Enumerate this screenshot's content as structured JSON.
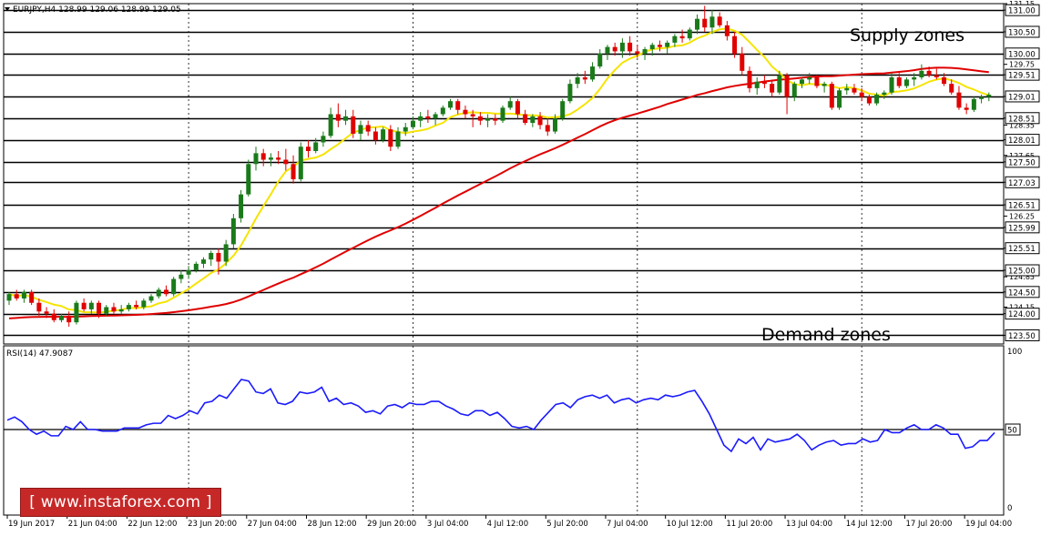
{
  "header": {
    "symbol_label": "EURJPY,H4 128.99 129.06 128.99 129.05",
    "rsi_label": "RSI(14) 47.9087"
  },
  "annotations": {
    "supply": "Supply zones",
    "demand": "Demand zones"
  },
  "watermark": "[ www.instaforex.com ]",
  "colors": {
    "background": "#ffffff",
    "bull_candle": "#1a7a1a",
    "bear_candle": "#e00000",
    "ma_fast": "#f5e400",
    "ma_slow": "#e00000",
    "rsi_line": "#1a1aff",
    "level_line": "#000000",
    "grid": "#000000",
    "watermark_bg": "#c62828"
  },
  "chart_data": [
    {
      "type": "candlestick",
      "title": "EURJPY,H4 128.99 129.06 128.99 129.05",
      "ylim": [
        123.3,
        131.15
      ],
      "y_ticks": [
        "131.15",
        "131.00",
        "130.50",
        "129.75",
        "129.51",
        "129.01",
        "128.51",
        "128.35",
        "128.01",
        "127.65",
        "127.50",
        "127.03",
        "126.51",
        "126.25",
        "125.99",
        "125.51",
        "125.00",
        "124.85",
        "124.50",
        "124.15",
        "124.00",
        "123.50"
      ],
      "horizontal_levels": [
        131.0,
        130.5,
        130.0,
        129.51,
        129.01,
        128.51,
        128.01,
        127.5,
        127.03,
        126.51,
        125.99,
        125.51,
        125.0,
        124.5,
        124.0,
        123.5
      ],
      "level_labels": [
        "131.00",
        "130.50",
        "130.00",
        "129.51",
        "129.01",
        "128.51",
        "128.01",
        "127.50",
        "127.03",
        "126.51",
        "125.99",
        "125.51",
        "125.00",
        "124.50",
        "124.00",
        "123.50"
      ],
      "x_tick_labels": [
        "19 Jun 2017",
        "21 Jun 04:00",
        "22 Jun 12:00",
        "23 Jun 20:00",
        "27 Jun 04:00",
        "28 Jun 12:00",
        "29 Jun 20:00",
        "3 Jul 04:00",
        "4 Jul 12:00",
        "5 Jul 20:00",
        "7 Jul 04:00",
        "10 Jul 12:00",
        "11 Jul 20:00",
        "13 Jul 04:00",
        "14 Jul 12:00",
        "17 Jul 20:00",
        "19 Jul 04:00"
      ],
      "x_tick_candle_index": [
        0,
        8,
        16,
        24,
        32,
        40,
        48,
        56,
        64,
        72,
        80,
        88,
        96,
        104,
        112,
        120,
        128
      ],
      "vertical_grid_candle_index": [
        24,
        54,
        84,
        114
      ],
      "ohlc": [
        [
          124.3,
          124.5,
          124.2,
          124.45
        ],
        [
          124.45,
          124.55,
          124.3,
          124.35
        ],
        [
          124.35,
          124.55,
          124.25,
          124.5
        ],
        [
          124.5,
          124.55,
          124.2,
          124.25
        ],
        [
          124.25,
          124.35,
          123.95,
          124.05
        ],
        [
          124.05,
          124.15,
          123.9,
          124.0
        ],
        [
          124.0,
          124.1,
          123.8,
          123.85
        ],
        [
          123.85,
          124.0,
          123.8,
          123.95
        ],
        [
          123.95,
          124.05,
          123.7,
          123.8
        ],
        [
          123.8,
          124.3,
          123.75,
          124.25
        ],
        [
          124.25,
          124.35,
          124.05,
          124.1
        ],
        [
          124.1,
          124.3,
          124.0,
          124.25
        ],
        [
          124.25,
          124.3,
          123.9,
          124.0
        ],
        [
          124.0,
          124.2,
          123.95,
          124.15
        ],
        [
          124.15,
          124.25,
          124.0,
          124.05
        ],
        [
          124.05,
          124.2,
          124.0,
          124.1
        ],
        [
          124.1,
          124.25,
          124.05,
          124.2
        ],
        [
          124.2,
          124.3,
          124.1,
          124.15
        ],
        [
          124.15,
          124.35,
          124.1,
          124.3
        ],
        [
          124.3,
          124.45,
          124.25,
          124.4
        ],
        [
          124.4,
          124.6,
          124.35,
          124.55
        ],
        [
          124.55,
          124.65,
          124.4,
          124.45
        ],
        [
          124.45,
          124.85,
          124.4,
          124.8
        ],
        [
          124.8,
          125.0,
          124.7,
          124.9
        ],
        [
          124.9,
          125.1,
          124.8,
          125.0
        ],
        [
          125.0,
          125.2,
          124.95,
          125.15
        ],
        [
          125.15,
          125.3,
          125.05,
          125.25
        ],
        [
          125.25,
          125.45,
          125.1,
          125.4
        ],
        [
          125.4,
          125.5,
          124.9,
          125.2
        ],
        [
          125.2,
          125.7,
          125.1,
          125.6
        ],
        [
          125.6,
          126.3,
          125.5,
          126.2
        ],
        [
          126.2,
          126.85,
          126.1,
          126.75
        ],
        [
          126.75,
          127.55,
          126.7,
          127.45
        ],
        [
          127.45,
          127.85,
          127.3,
          127.7
        ],
        [
          127.7,
          127.8,
          127.4,
          127.55
        ],
        [
          127.55,
          127.7,
          127.4,
          127.6
        ],
        [
          127.6,
          127.75,
          127.45,
          127.55
        ],
        [
          127.55,
          127.8,
          127.3,
          127.45
        ],
        [
          127.45,
          127.65,
          127.0,
          127.1
        ],
        [
          127.1,
          127.95,
          127.05,
          127.85
        ],
        [
          127.85,
          128.0,
          127.6,
          127.75
        ],
        [
          127.75,
          128.05,
          127.7,
          127.95
        ],
        [
          127.95,
          128.2,
          127.85,
          128.1
        ],
        [
          128.1,
          128.75,
          128.05,
          128.6
        ],
        [
          128.6,
          128.85,
          128.3,
          128.45
        ],
        [
          128.45,
          128.7,
          128.35,
          128.55
        ],
        [
          128.55,
          128.7,
          128.05,
          128.15
        ],
        [
          128.15,
          128.45,
          128.0,
          128.35
        ],
        [
          128.35,
          128.45,
          128.1,
          128.2
        ],
        [
          128.2,
          128.3,
          127.9,
          128.0
        ],
        [
          128.0,
          128.3,
          127.95,
          128.25
        ],
        [
          128.25,
          128.35,
          127.75,
          127.85
        ],
        [
          127.85,
          128.3,
          127.8,
          128.2
        ],
        [
          128.2,
          128.4,
          128.1,
          128.3
        ],
        [
          128.3,
          128.55,
          128.25,
          128.45
        ],
        [
          128.45,
          128.65,
          128.3,
          128.55
        ],
        [
          128.55,
          128.7,
          128.4,
          128.5
        ],
        [
          128.5,
          128.65,
          128.35,
          128.6
        ],
        [
          128.6,
          128.8,
          128.55,
          128.75
        ],
        [
          128.75,
          128.95,
          128.7,
          128.9
        ],
        [
          128.9,
          128.95,
          128.6,
          128.7
        ],
        [
          128.7,
          128.8,
          128.5,
          128.6
        ],
        [
          128.6,
          128.7,
          128.3,
          128.55
        ],
        [
          128.55,
          128.65,
          128.35,
          128.45
        ],
        [
          128.45,
          128.6,
          128.3,
          128.5
        ],
        [
          128.5,
          128.6,
          128.35,
          128.45
        ],
        [
          128.45,
          128.8,
          128.4,
          128.75
        ],
        [
          128.75,
          129.0,
          128.7,
          128.9
        ],
        [
          128.9,
          128.95,
          128.5,
          128.6
        ],
        [
          128.6,
          128.7,
          128.35,
          128.4
        ],
        [
          128.4,
          128.6,
          128.3,
          128.55
        ],
        [
          128.55,
          128.65,
          128.25,
          128.35
        ],
        [
          128.35,
          128.5,
          128.1,
          128.2
        ],
        [
          128.2,
          128.6,
          128.15,
          128.5
        ],
        [
          128.5,
          128.95,
          128.45,
          128.9
        ],
        [
          128.9,
          129.4,
          128.85,
          129.3
        ],
        [
          129.3,
          129.55,
          129.2,
          129.45
        ],
        [
          129.45,
          129.6,
          129.3,
          129.4
        ],
        [
          129.4,
          129.8,
          129.35,
          129.7
        ],
        [
          129.7,
          130.1,
          129.65,
          130.0
        ],
        [
          130.0,
          130.2,
          129.85,
          130.15
        ],
        [
          130.15,
          130.25,
          129.95,
          130.05
        ],
        [
          130.05,
          130.35,
          129.9,
          130.25
        ],
        [
          130.25,
          130.4,
          129.95,
          130.05
        ],
        [
          130.05,
          130.2,
          129.9,
          130.0
        ],
        [
          130.0,
          130.15,
          129.85,
          130.1
        ],
        [
          130.1,
          130.25,
          129.95,
          130.2
        ],
        [
          130.2,
          130.3,
          130.05,
          130.15
        ],
        [
          130.15,
          130.3,
          130.0,
          130.25
        ],
        [
          130.25,
          130.45,
          130.15,
          130.4
        ],
        [
          130.4,
          130.55,
          130.25,
          130.35
        ],
        [
          130.35,
          130.6,
          130.3,
          130.55
        ],
        [
          130.55,
          130.9,
          130.45,
          130.8
        ],
        [
          130.8,
          131.1,
          130.5,
          130.6
        ],
        [
          130.6,
          131.0,
          130.45,
          130.85
        ],
        [
          130.85,
          130.95,
          130.6,
          130.65
        ],
        [
          130.65,
          130.75,
          130.3,
          130.4
        ],
        [
          130.4,
          130.5,
          129.9,
          130.0
        ],
        [
          130.0,
          130.15,
          129.5,
          129.6
        ],
        [
          129.6,
          129.7,
          129.1,
          129.2
        ],
        [
          129.2,
          129.45,
          129.05,
          129.35
        ],
        [
          129.35,
          129.5,
          129.2,
          129.3
        ],
        [
          129.3,
          129.4,
          129.0,
          129.1
        ],
        [
          129.1,
          129.6,
          129.05,
          129.5
        ],
        [
          129.5,
          129.55,
          128.6,
          129.0
        ],
        [
          129.0,
          129.35,
          128.9,
          129.3
        ],
        [
          129.3,
          129.45,
          129.2,
          129.4
        ],
        [
          129.4,
          129.55,
          129.3,
          129.45
        ],
        [
          129.45,
          129.5,
          129.2,
          129.25
        ],
        [
          129.25,
          129.35,
          129.1,
          129.3
        ],
        [
          129.3,
          129.35,
          128.7,
          128.75
        ],
        [
          128.75,
          129.2,
          128.7,
          129.15
        ],
        [
          129.15,
          129.3,
          129.05,
          129.2
        ],
        [
          129.2,
          129.3,
          129.05,
          129.1
        ],
        [
          129.1,
          129.2,
          128.9,
          129.0
        ],
        [
          129.0,
          129.05,
          128.8,
          128.85
        ],
        [
          128.85,
          129.1,
          128.8,
          129.05
        ],
        [
          129.05,
          129.15,
          128.95,
          129.1
        ],
        [
          129.1,
          129.55,
          129.05,
          129.45
        ],
        [
          129.45,
          129.55,
          129.2,
          129.25
        ],
        [
          129.25,
          129.45,
          129.2,
          129.4
        ],
        [
          129.4,
          129.55,
          129.25,
          129.45
        ],
        [
          129.45,
          129.75,
          129.4,
          129.6
        ],
        [
          129.6,
          129.7,
          129.45,
          129.5
        ],
        [
          129.5,
          129.65,
          129.4,
          129.45
        ],
        [
          129.45,
          129.55,
          129.25,
          129.3
        ],
        [
          129.3,
          129.4,
          129.05,
          129.1
        ],
        [
          129.1,
          129.25,
          128.7,
          128.75
        ],
        [
          128.75,
          128.85,
          128.6,
          128.7
        ],
        [
          128.7,
          129.0,
          128.65,
          128.95
        ],
        [
          128.95,
          129.05,
          128.85,
          129.0
        ],
        [
          129.0,
          129.1,
          128.9,
          129.05
        ]
      ],
      "moving_averages": [
        {
          "name": "fast",
          "color": "#f5e400",
          "period": 8
        },
        {
          "name": "slow",
          "color": "#e00000",
          "period": 50
        }
      ]
    },
    {
      "type": "line",
      "title": "RSI(14) 47.9087",
      "ylim": [
        0,
        100
      ],
      "y_ticks": [
        "100",
        "50",
        "0"
      ],
      "reference_line": 50,
      "series": [
        {
          "name": "RSI(14)",
          "values": [
            56,
            58,
            55,
            50,
            47,
            49,
            46,
            46,
            52,
            50,
            55,
            50,
            50,
            49,
            49,
            49,
            51,
            51,
            51,
            53,
            54,
            54,
            59,
            57,
            59,
            62,
            60,
            67,
            68,
            72,
            70,
            76,
            82,
            81,
            74,
            73,
            76,
            67,
            66,
            68,
            74,
            73,
            74,
            77,
            68,
            70,
            66,
            67,
            65,
            61,
            62,
            60,
            65,
            66,
            64,
            67,
            66,
            66,
            68,
            68,
            65,
            63,
            60,
            59,
            62,
            62,
            59,
            61,
            57,
            52,
            51,
            52,
            50,
            56,
            61,
            66,
            67,
            64,
            69,
            71,
            72,
            70,
            72,
            67,
            69,
            70,
            67,
            69,
            70,
            69,
            72,
            71,
            72,
            74,
            75,
            68,
            60,
            50,
            40,
            36,
            44,
            41,
            45,
            37,
            44,
            42,
            43,
            44,
            47,
            43,
            37,
            40,
            42,
            43,
            40,
            41,
            41,
            44,
            42,
            43,
            50,
            48,
            48,
            51,
            53,
            50,
            50,
            53,
            51,
            47,
            47,
            38,
            39,
            43,
            43,
            48
          ]
        }
      ]
    }
  ]
}
